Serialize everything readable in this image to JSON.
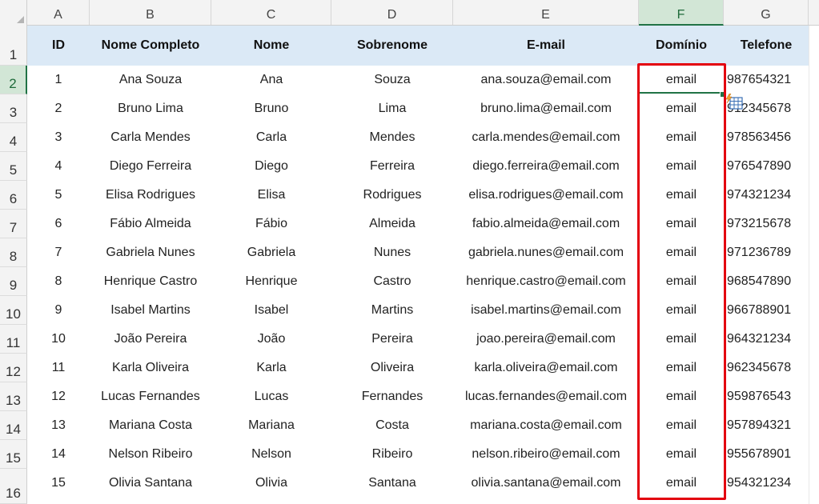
{
  "sheet": {
    "columns": [
      "A",
      "B",
      "C",
      "D",
      "E",
      "F",
      "G"
    ],
    "selected_column": "F",
    "rows": [
      "1",
      "2",
      "3",
      "4",
      "5",
      "6",
      "7",
      "8",
      "9",
      "10",
      "11",
      "12",
      "13",
      "14",
      "15",
      "16"
    ],
    "selected_row": "2"
  },
  "table": {
    "headers": [
      "ID",
      "Nome Completo",
      "Nome",
      "Sobrenome",
      "E-mail",
      "Domínio",
      "Telefone"
    ],
    "data": [
      [
        "1",
        "Ana Souza",
        "Ana",
        "Souza",
        "ana.souza@email.com",
        "email",
        "987654321"
      ],
      [
        "2",
        "Bruno Lima",
        "Bruno",
        "Lima",
        "bruno.lima@email.com",
        "email",
        "912345678"
      ],
      [
        "3",
        "Carla Mendes",
        "Carla",
        "Mendes",
        "carla.mendes@email.com",
        "email",
        "978563456"
      ],
      [
        "4",
        "Diego Ferreira",
        "Diego",
        "Ferreira",
        "diego.ferreira@email.com",
        "email",
        "976547890"
      ],
      [
        "5",
        "Elisa Rodrigues",
        "Elisa",
        "Rodrigues",
        "elisa.rodrigues@email.com",
        "email",
        "974321234"
      ],
      [
        "6",
        "Fábio Almeida",
        "Fábio",
        "Almeida",
        "fabio.almeida@email.com",
        "email",
        "973215678"
      ],
      [
        "7",
        "Gabriela Nunes",
        "Gabriela",
        "Nunes",
        "gabriela.nunes@email.com",
        "email",
        "971236789"
      ],
      [
        "8",
        "Henrique Castro",
        "Henrique",
        "Castro",
        "henrique.castro@email.com",
        "email",
        "968547890"
      ],
      [
        "9",
        "Isabel Martins",
        "Isabel",
        "Martins",
        "isabel.martins@email.com",
        "email",
        "966788901"
      ],
      [
        "10",
        "João Pereira",
        "João",
        "Pereira",
        "joao.pereira@email.com",
        "email",
        "964321234"
      ],
      [
        "11",
        "Karla Oliveira",
        "Karla",
        "Oliveira",
        "karla.oliveira@email.com",
        "email",
        "962345678"
      ],
      [
        "12",
        "Lucas Fernandes",
        "Lucas",
        "Fernandes",
        "lucas.fernandes@email.com",
        "email",
        "959876543"
      ],
      [
        "13",
        "Mariana Costa",
        "Mariana",
        "Costa",
        "mariana.costa@email.com",
        "email",
        "957894321"
      ],
      [
        "14",
        "Nelson Ribeiro",
        "Nelson",
        "Ribeiro",
        "nelson.ribeiro@email.com",
        "email",
        "955678901"
      ],
      [
        "15",
        "Olivia Santana",
        "Olivia",
        "Santana",
        "olivia.santana@email.com",
        "email",
        "954321234"
      ]
    ]
  },
  "icons": {
    "flash_fill": "flash-fill-options-icon"
  },
  "colors": {
    "header_fill": "#dbe9f6",
    "highlight_border": "#e3000f",
    "selection_green": "#217346"
  }
}
